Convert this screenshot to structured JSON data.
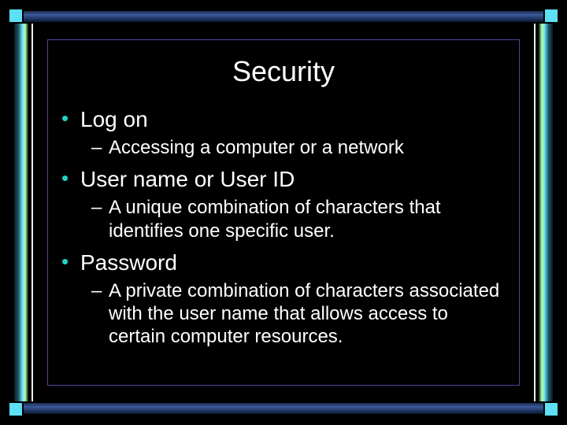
{
  "title": "Security",
  "bullets": [
    {
      "label": "Log on",
      "sub": "Accessing a computer or a network"
    },
    {
      "label": "User name or User ID",
      "sub": "A unique combination of characters that identifies one specific user."
    },
    {
      "label": "Password",
      "sub": "A private combination of characters associated with the user name that allows access to certain computer resources."
    }
  ]
}
